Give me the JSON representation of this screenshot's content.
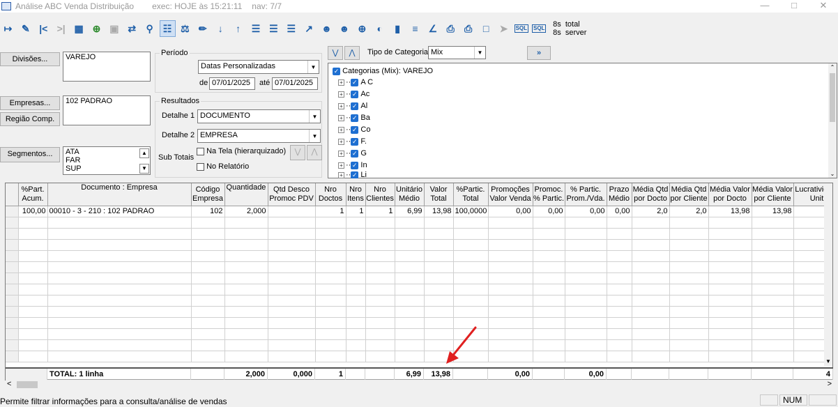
{
  "window": {
    "title": "Análise ABC Venda Distribuição",
    "exec": "exec: HOJE às 15:21:11",
    "nav": "nav: 7/7"
  },
  "toolbar": {
    "icons": [
      "exit-icon",
      "eraser-icon",
      "first-icon",
      "last-icon",
      "table-icon",
      "add-icon",
      "save-icon",
      "filter-icon",
      "search-icon",
      "calculator-icon",
      "scale-icon",
      "edit-icon",
      "sort-desc-icon",
      "sort-asc-icon",
      "list-icon",
      "list2-icon",
      "list3-icon",
      "export-icon",
      "user-icon",
      "user2-icon",
      "zoom-icon",
      "pie-chart-icon",
      "bar-chart-icon",
      "hbar-chart-icon",
      "line-chart-icon",
      "print-icon",
      "printer2-icon",
      "document-icon",
      "send-icon",
      "sql-icon",
      "sql2-icon"
    ],
    "sql_label": "SQL",
    "time_total": "8s  total",
    "time_server": "8s  server"
  },
  "filters": {
    "divisoes_btn": "Divisões...",
    "divisoes_value": "VAREJO",
    "empresas_btn": "Empresas...",
    "regiao_btn": "Região Comp.",
    "empresas_value": "102 PADRAO",
    "segmentos_btn": "Segmentos...",
    "segmentos_values": [
      "ATA",
      "FAR",
      "SUP"
    ]
  },
  "periodo": {
    "label": "Período",
    "tipo": "Datas Personalizadas",
    "de_label": "de",
    "de": "07/01/2025",
    "ate_label": "até",
    "ate": "07/01/2025"
  },
  "resultados": {
    "label": "Resultados",
    "det1_label": "Detalhe 1",
    "det1": "DOCUMENTO",
    "det2_label": "Detalhe 2",
    "det2": "EMPRESA",
    "subtotais_label": "Sub Totais",
    "na_tela": "Na Tela (hierarquizado)",
    "no_relatorio": "No Relatório"
  },
  "categoria": {
    "label": "Tipo de Categoria",
    "value": "Mix",
    "root": "Categorias (Mix): VAREJO",
    "items": [
      "A C",
      "Ac",
      "Al",
      "Ba",
      "Co",
      "F.",
      "G",
      "In",
      "Li"
    ]
  },
  "grid": {
    "headers": [
      "%Part. Acum.",
      "Documento : Empresa",
      "Código Empresa",
      "Quantidade",
      "Qtd Desco Promoc PDV",
      "Nro Doctos",
      "Nro Itens",
      "Nro Clientes",
      "Unitário Médio",
      "Valor Total",
      "%Partic. Total",
      "Promoções Valor Venda",
      "Promoc. % Partic.",
      "% Partic. Prom./Vda.",
      "Prazo Médio",
      "Média Qtd por Docto",
      "Média Qtd por Cliente",
      "Média Valor por Docto",
      "Média Valor por Cliente",
      "Lucratividade Unit."
    ],
    "rows": [
      [
        "100,00",
        "00010 - 3 - 210 : 102 PADRAO",
        "102",
        "2,000",
        "",
        "1",
        "1",
        "1",
        "6,99",
        "13,98",
        "100,0000",
        "0,00",
        "0,00",
        "0,00",
        "0,00",
        "2,0",
        "2,0",
        "13,98",
        "13,98",
        "4"
      ]
    ],
    "total": {
      "label": "TOTAL: 1 linha",
      "quantidade": "2,000",
      "qtd_desco": "0,000",
      "nro_doctos": "1",
      "unitario": "6,99",
      "valor_total": "13,98",
      "promocoes": "0,00",
      "partic_prom": "0,00",
      "lucr": "4"
    }
  },
  "status": {
    "text": "Permite filtrar informações para a consulta/análise de vendas",
    "num": "NUM"
  },
  "colors": {
    "accent": "#1f5fa8",
    "arrow": "#e02020",
    "check": "#1e6fd1"
  }
}
